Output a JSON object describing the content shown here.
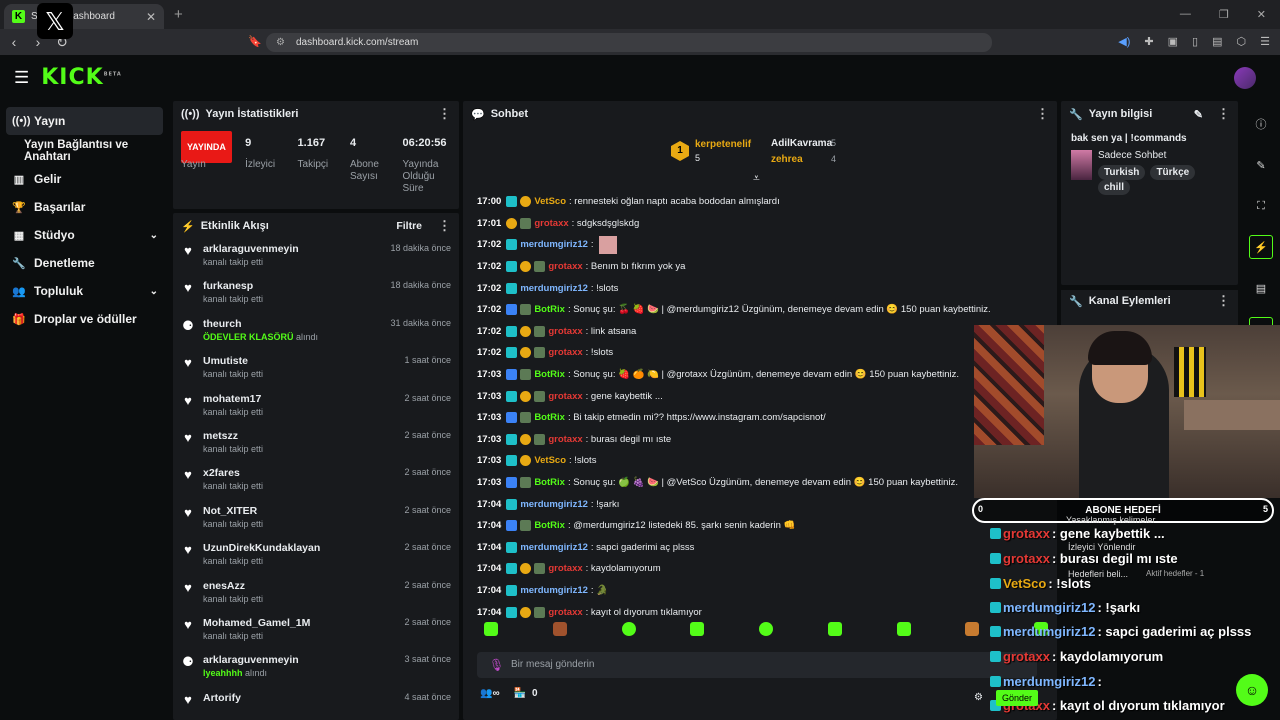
{
  "browser": {
    "tab_title": "Stream Dashboard",
    "url": "dashboard.kick.com/stream"
  },
  "header": {
    "logo": "KICK",
    "logo_sup": "BETA"
  },
  "sidebar": {
    "items": [
      {
        "label": "Yayın",
        "icon": "broadcast-icon"
      },
      {
        "label": "Yayın Bağlantısı ve Anahtarı",
        "icon": ""
      },
      {
        "label": "Gelir",
        "icon": "chart-icon"
      },
      {
        "label": "Başarılar",
        "icon": "trophy-icon"
      },
      {
        "label": "Stüdyo",
        "icon": "grid-icon"
      },
      {
        "label": "Denetleme",
        "icon": "wrench-icon"
      },
      {
        "label": "Topluluk",
        "icon": "people-icon"
      },
      {
        "label": "Droplar ve ödüller",
        "icon": "gift-icon"
      }
    ]
  },
  "stats": {
    "title": "Yayın İstatistikleri",
    "live_badge": "YAYINDA",
    "live_label": "Yayın",
    "viewers": "9",
    "viewers_label": "İzleyici",
    "followers": "1.167",
    "followers_label": "Takipçi",
    "subs": "4",
    "subs_label": "Abone Sayısı",
    "uptime": "06:20:56",
    "uptime_label": "Yayında Olduğu Süre"
  },
  "activity": {
    "title": "Etkinlik Akışı",
    "filter": "Filtre",
    "events": [
      {
        "name": "arklaraguvenmeyin",
        "sub": "kanalı takip etti",
        "time": "18 dakika önce",
        "type": "follow"
      },
      {
        "name": "furkanesp",
        "sub": "kanalı takip etti",
        "time": "18 dakika önce",
        "type": "follow"
      },
      {
        "name": "theurch",
        "sub": "alındı",
        "sub_hl": "ÖDEVLER KLASÖRÜ",
        "time": "31 dakika önce",
        "type": "reward"
      },
      {
        "name": "Umutiste",
        "sub": "kanalı takip etti",
        "time": "1 saat önce",
        "type": "follow"
      },
      {
        "name": "mohatem17",
        "sub": "kanalı takip etti",
        "time": "2 saat önce",
        "type": "follow"
      },
      {
        "name": "metszz",
        "sub": "kanalı takip etti",
        "time": "2 saat önce",
        "type": "follow"
      },
      {
        "name": "x2fares",
        "sub": "kanalı takip etti",
        "time": "2 saat önce",
        "type": "follow"
      },
      {
        "name": "Not_XITER",
        "sub": "kanalı takip etti",
        "time": "2 saat önce",
        "type": "follow"
      },
      {
        "name": "UzunDirekKundaklayan",
        "sub": "kanalı takip etti",
        "time": "2 saat önce",
        "type": "follow"
      },
      {
        "name": "enesAzz",
        "sub": "kanalı takip etti",
        "time": "2 saat önce",
        "type": "follow"
      },
      {
        "name": "Mohamed_Gamel_1M",
        "sub": "kanalı takip etti",
        "time": "2 saat önce",
        "type": "follow"
      },
      {
        "name": "arklaraguvenmeyin",
        "sub": "alındı",
        "sub_hl": "lyeahhhh",
        "time": "3 saat önce",
        "type": "reward"
      },
      {
        "name": "Artorify",
        "sub": "",
        "time": "4 saat önce",
        "type": "follow"
      }
    ]
  },
  "chat": {
    "title": "Sohbet",
    "top_gifters": [
      {
        "name": "kerpetenelif",
        "count": "5",
        "rank": "1"
      },
      {
        "name": "AdilKavrama",
        "count": "5"
      },
      {
        "name": "zehrea",
        "count": "4"
      }
    ],
    "messages": [
      {
        "time": "17:00",
        "user": "VetSco",
        "color": "#e8a913",
        "text": ": rennesteki oğlan naptı acaba bododan almışlardı",
        "badges": [
          "sub",
          "og"
        ]
      },
      {
        "time": "17:01",
        "user": "grotaxx",
        "color": "#e53935",
        "text": ": sdgksdşglskdg",
        "badges": [
          "og",
          "gr"
        ]
      },
      {
        "time": "17:02",
        "user": "merdumgiriz12",
        "color": "#7fb7ff",
        "text": ":",
        "badges": [
          "sub"
        ],
        "emote": true
      },
      {
        "time": "17:02",
        "user": "grotaxx",
        "color": "#e53935",
        "text": ": Benım bı fıkrım yok ya",
        "badges": [
          "sub",
          "og",
          "gr"
        ]
      },
      {
        "time": "17:02",
        "user": "merdumgiriz12",
        "color": "#7fb7ff",
        "text": ": !slots",
        "badges": [
          "sub"
        ]
      },
      {
        "time": "17:02",
        "user": "BotRix",
        "color": "#53fc18",
        "text": ": Sonuç şu: 🍒 🍓 🍉 | @merdumgiriz12 Üzgünüm, denemeye devam edin 😊 150 puan kaybettiniz.",
        "badges": [
          "bot",
          "gr"
        ]
      },
      {
        "time": "17:02",
        "user": "grotaxx",
        "color": "#e53935",
        "text": ": link atsana",
        "badges": [
          "sub",
          "og",
          "gr"
        ]
      },
      {
        "time": "17:02",
        "user": "grotaxx",
        "color": "#e53935",
        "text": ": !slots",
        "badges": [
          "sub",
          "og",
          "gr"
        ]
      },
      {
        "time": "17:03",
        "user": "BotRix",
        "color": "#53fc18",
        "text": ": Sonuç şu: 🍓 🍊 🍋 | @grotaxx Üzgünüm, denemeye devam edin 😊 150 puan kaybettiniz.",
        "badges": [
          "bot",
          "gr"
        ]
      },
      {
        "time": "17:03",
        "user": "grotaxx",
        "color": "#e53935",
        "text": ": gene kaybettik ...",
        "badges": [
          "sub",
          "og",
          "gr"
        ]
      },
      {
        "time": "17:03",
        "user": "BotRix",
        "color": "#53fc18",
        "text": ": Bi takip etmedin mi?? https://www.instagram.com/sapcisnot/",
        "badges": [
          "bot",
          "gr"
        ]
      },
      {
        "time": "17:03",
        "user": "grotaxx",
        "color": "#e53935",
        "text": ": burası degil mı ıste",
        "badges": [
          "sub",
          "og",
          "gr"
        ]
      },
      {
        "time": "17:03",
        "user": "VetSco",
        "color": "#e8a913",
        "text": ": !slots",
        "badges": [
          "sub",
          "og"
        ]
      },
      {
        "time": "17:03",
        "user": "BotRix",
        "color": "#53fc18",
        "text": ": Sonuç şu: 🍏 🍇 🍉 | @VetSco Üzgünüm, denemeye devam edin 😊 150 puan kaybettiniz.",
        "badges": [
          "bot",
          "gr"
        ]
      },
      {
        "time": "17:04",
        "user": "merdumgiriz12",
        "color": "#7fb7ff",
        "text": ": !şarkı",
        "badges": [
          "sub"
        ]
      },
      {
        "time": "17:04",
        "user": "BotRix",
        "color": "#53fc18",
        "text": ": @merdumgiriz12 listedeki 85. şarkı senin kaderin 👊",
        "badges": [
          "bot",
          "gr"
        ]
      },
      {
        "time": "17:04",
        "user": "merdumgiriz12",
        "color": "#7fb7ff",
        "text": ": sapci gaderimi aç plsss",
        "badges": [
          "sub"
        ]
      },
      {
        "time": "17:04",
        "user": "grotaxx",
        "color": "#e53935",
        "text": ": kaydolamıyorum",
        "badges": [
          "sub",
          "og",
          "gr"
        ]
      },
      {
        "time": "17:04",
        "user": "merdumgiriz12",
        "color": "#7fb7ff",
        "text": ": 🐊",
        "badges": [
          "sub"
        ]
      },
      {
        "time": "17:04",
        "user": "grotaxx",
        "color": "#e53935",
        "text": ": kayıt ol dıyorum tıklamıyor",
        "badges": [
          "sub",
          "og",
          "gr"
        ]
      }
    ],
    "input_placeholder": "Bir mesaj gönderin",
    "viewers_count": "0",
    "send_label": "Gönder"
  },
  "stream_info": {
    "title": "Yayın bilgisi",
    "stream_title": "bak sen ya | !commands",
    "category": "Sadece Sohbet",
    "tags": [
      "Turkish",
      "Türkçe",
      "chill"
    ]
  },
  "channel_actions": {
    "title": "Kanal Eylemleri"
  },
  "overlay": {
    "goal_label": "ABONE HEDEFİ",
    "goal_start": "0",
    "goal_end": "5",
    "hidden1": "Yasaklanmış kelimeler",
    "hidden2": "İzleyici Yönlendir",
    "hidden3": "Hedefleri beli...",
    "hidden3b": "Aktif hedefler - 1",
    "lines": [
      {
        "user": "grotaxx",
        "color": "#e53935",
        "text": " : gene kaybettik ..."
      },
      {
        "user": "grotaxx",
        "color": "#e53935",
        "text": " : burası degil mı ıste"
      },
      {
        "user": "VetSco",
        "color": "#e8a913",
        "text": " : !slots"
      },
      {
        "user": "merdumgiriz12",
        "color": "#7fb7ff",
        "text": " : !şarkı"
      },
      {
        "user": "merdumgiriz12",
        "color": "#7fb7ff",
        "text": " : sapci gaderimi aç plsss"
      },
      {
        "user": "grotaxx",
        "color": "#e53935",
        "text": " : kaydolamıyorum"
      },
      {
        "user": "merdumgiriz12",
        "color": "#7fb7ff",
        "text": " :"
      },
      {
        "user": "grotaxx",
        "color": "#e53935",
        "text": " : kayıt ol dıyorum tıklamıyor"
      }
    ]
  }
}
